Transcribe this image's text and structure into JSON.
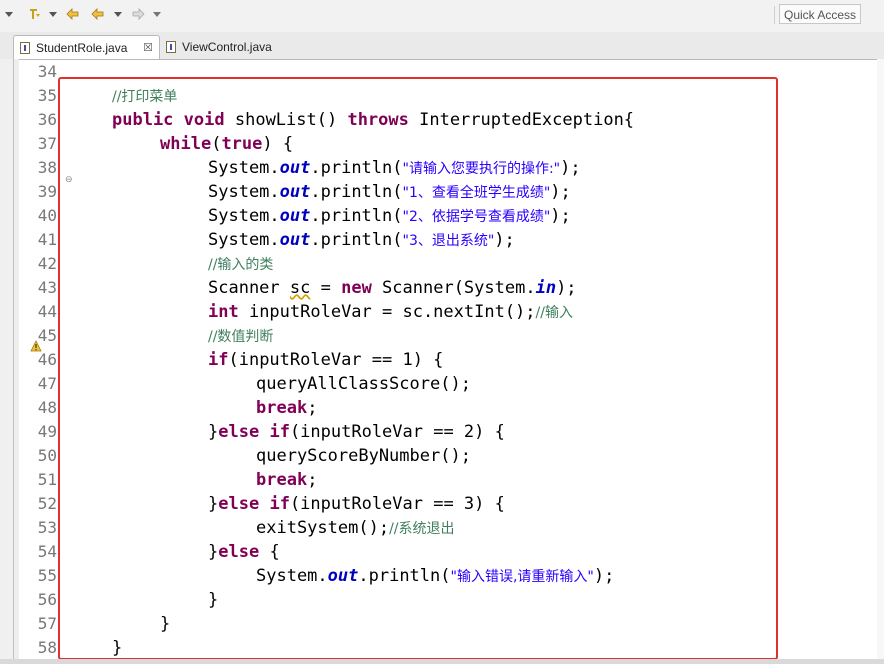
{
  "toolbar": {
    "quick_access_label": "Quick Access",
    "icons": [
      "dropdown-arrow-icon",
      "pin-icon",
      "dropdown-arrow-icon",
      "back-yellow-icon",
      "back-arrow-icon",
      "dropdown-arrow-icon",
      "forward-arrow-icon",
      "dropdown-arrow-icon"
    ]
  },
  "tabs": [
    {
      "label": "StudentRole.java",
      "active": true,
      "close": "☒"
    },
    {
      "label": "ViewControl.java",
      "active": false
    }
  ],
  "editor": {
    "line_numbers": [
      "34",
      "35",
      "36",
      "37",
      "38",
      "39",
      "40",
      "41",
      "42",
      "43",
      "44",
      "45",
      "46",
      "47",
      "48",
      "49",
      "50",
      "51",
      "52",
      "53",
      "54",
      "55",
      "56",
      "57",
      "58"
    ],
    "colors": {
      "keyword": "#7f0055",
      "field": "#0000c0",
      "string": "#2a00ff",
      "comment": "#3f7f5f",
      "highlight_border": "#e03030"
    },
    "code": {
      "l35": {
        "comment": "//打印菜单"
      },
      "l36": {
        "kw1": "public",
        "kw2": "void",
        "text1": " showList() ",
        "kw3": "throws",
        "text2": " InterruptedException{"
      },
      "l37": {
        "kw1": "while",
        "text1": "(",
        "kw2": "true",
        "text2": ") {"
      },
      "l38": {
        "text1": "System.",
        "field": "out",
        "text2": ".println(",
        "str": "\"请输入您要执行的操作:\"",
        "text3": ");"
      },
      "l39": {
        "text1": "System.",
        "field": "out",
        "text2": ".println(",
        "str": "\"1、查看全班学生成绩\"",
        "text3": ");"
      },
      "l40": {
        "text1": "System.",
        "field": "out",
        "text2": ".println(",
        "str": "\"2、依据学号查看成绩\"",
        "text3": ");"
      },
      "l41": {
        "text1": "System.",
        "field": "out",
        "text2": ".println(",
        "str": "\"3、退出系统\"",
        "text3": ");"
      },
      "l42": {
        "comment": "//输入的类"
      },
      "l43": {
        "text1": "Scanner ",
        "var": "sc",
        "text2": " = ",
        "kw1": "new",
        "text3": " Scanner(System.",
        "field": "in",
        "text4": ");"
      },
      "l44": {
        "kw1": "int",
        "text1": " inputRoleVar = sc.nextInt();",
        "comment": "//输入"
      },
      "l45": {
        "comment": "//数值判断"
      },
      "l46": {
        "kw1": "if",
        "text1": "(inputRoleVar == 1) {"
      },
      "l47": {
        "text1": "queryAllClassScore();"
      },
      "l48": {
        "kw1": "break",
        "text1": ";"
      },
      "l49": {
        "text0": "}",
        "kw1": "else",
        "text1": " ",
        "kw2": "if",
        "text2": "(inputRoleVar == 2) {"
      },
      "l50": {
        "text1": "queryScoreByNumber();"
      },
      "l51": {
        "kw1": "break",
        "text1": ";"
      },
      "l52": {
        "text0": "}",
        "kw1": "else",
        "text1": " ",
        "kw2": "if",
        "text2": "(inputRoleVar == 3) {"
      },
      "l53": {
        "text1": "exitSystem();",
        "comment": "//系统退出"
      },
      "l54": {
        "text0": "}",
        "kw1": "else",
        "text1": " {"
      },
      "l55": {
        "text1": "System.",
        "field": "out",
        "text2": ".println(",
        "str": "\"输入错误,请重新输入\"",
        "text3": ");"
      },
      "l56": {
        "text1": "}"
      },
      "l57": {
        "text1": "}"
      },
      "l58": {
        "text1": "}"
      }
    }
  }
}
